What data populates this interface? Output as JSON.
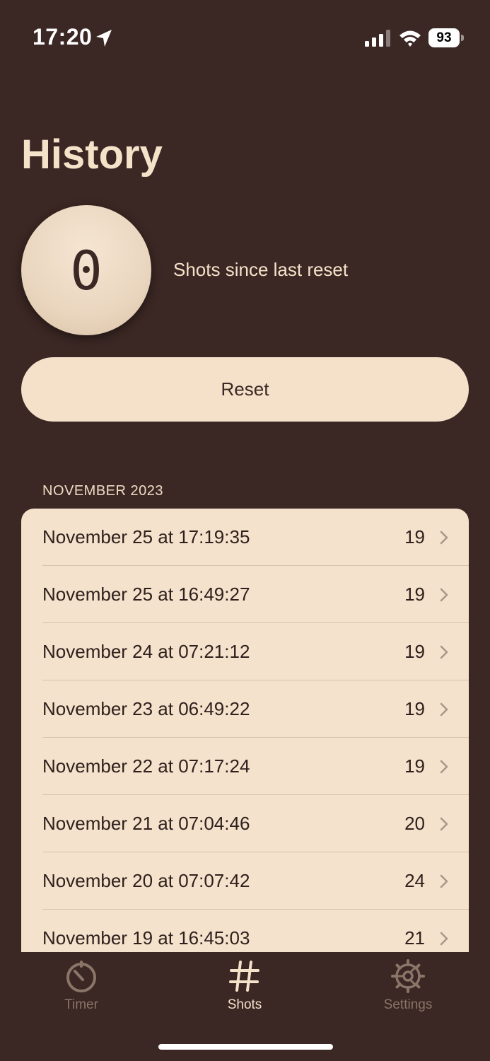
{
  "status_bar": {
    "time": "17:20",
    "battery": "93"
  },
  "page": {
    "title": "History"
  },
  "counter": {
    "value": "0",
    "label": "Shots since last reset"
  },
  "reset_button": {
    "label": "Reset"
  },
  "section": {
    "header": "NOVEMBER 2023",
    "items": [
      {
        "date": "November 25 at 17:19:35",
        "count": "19"
      },
      {
        "date": "November 25 at 16:49:27",
        "count": "19"
      },
      {
        "date": "November 24 at 07:21:12",
        "count": "19"
      },
      {
        "date": "November 23 at 06:49:22",
        "count": "19"
      },
      {
        "date": "November 22 at 07:17:24",
        "count": "19"
      },
      {
        "date": "November 21 at 07:04:46",
        "count": "20"
      },
      {
        "date": "November 20 at 07:07:42",
        "count": "24"
      },
      {
        "date": "November 19 at 16:45:03",
        "count": "21"
      }
    ]
  },
  "tab_bar": {
    "tabs": [
      {
        "label": "Timer",
        "icon": "timer-icon",
        "active": false
      },
      {
        "label": "Shots",
        "icon": "hash-icon",
        "active": true
      },
      {
        "label": "Settings",
        "icon": "gear-icon",
        "active": false
      }
    ]
  },
  "colors": {
    "background": "#3b2723",
    "card": "#f5e2cc",
    "accent_text": "#f4e2c9",
    "inactive_tab": "#8a7568"
  }
}
